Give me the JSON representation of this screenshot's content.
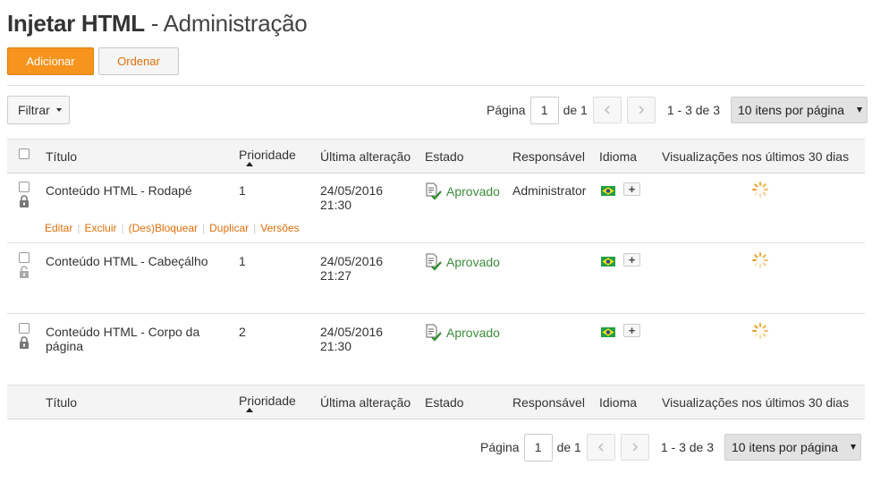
{
  "header": {
    "title_strong": "Injetar HTML",
    "title_light": " - Administração"
  },
  "toolbar": {
    "add_label": "Adicionar",
    "order_label": "Ordenar",
    "filter_label": "Filtrar"
  },
  "pager": {
    "page_label": "Página",
    "current_page": "1",
    "of_label": "de 1",
    "range_text": "1 - 3 de 3",
    "per_page_label": "10 itens por página"
  },
  "columns": {
    "title": "Título",
    "priority": "Prioridade",
    "last_change": "Última alteração",
    "state": "Estado",
    "responsible": "Responsável",
    "language": "Idioma",
    "views": "Visualizações nos últimos 30 dias"
  },
  "rows": [
    {
      "title": "Conteúdo HTML - Rodapé",
      "title_line2": "",
      "priority": "1",
      "date": "24/05/2016",
      "time": "21:30",
      "state": "Aprovado",
      "responsible": "Administrator",
      "locked": true
    },
    {
      "title": "Conteúdo HTML - Cabeçálho",
      "title_line2": "",
      "priority": "1",
      "date": "24/05/2016",
      "time": "21:27",
      "state": "Aprovado",
      "responsible": "",
      "locked": false
    },
    {
      "title": "Conteúdo HTML - Corpo da",
      "title_line2": "página",
      "priority": "2",
      "date": "24/05/2016",
      "time": "21:30",
      "state": "Aprovado",
      "responsible": "",
      "locked": true
    }
  ],
  "row_actions": {
    "edit": "Editar",
    "delete": "Excluir",
    "lock": "(Des)Bloquear",
    "duplicate": "Duplicar",
    "versions": "Versões",
    "plus": "+"
  },
  "colors": {
    "accent": "#f7941d",
    "link": "#e06f0a",
    "approved": "#3c8c3c"
  },
  "icons": {
    "state": "approved-document-icon",
    "lock": "lock-icon",
    "flag": "brazil-flag-icon",
    "views": "loading-spinner-icon"
  }
}
